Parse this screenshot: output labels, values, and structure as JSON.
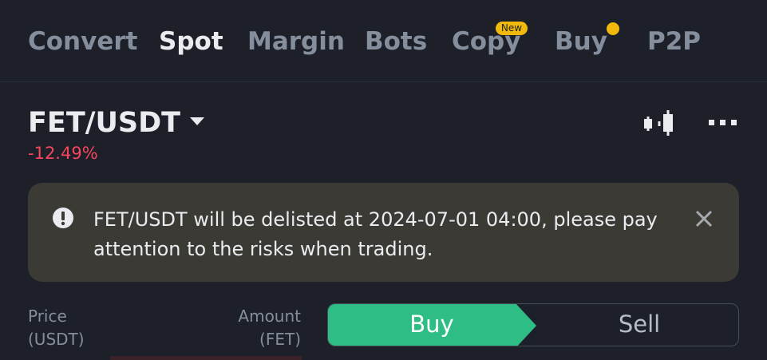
{
  "tabs": [
    {
      "label": "Convert"
    },
    {
      "label": "Spot"
    },
    {
      "label": "Margin"
    },
    {
      "label": "Bots"
    },
    {
      "label": "Copy"
    },
    {
      "label": "Buy"
    },
    {
      "label": "P2P"
    }
  ],
  "active_tab": "Spot",
  "copy_badge": "New",
  "pair": {
    "symbol": "FET/USDT",
    "change": "-12.49%"
  },
  "header_icons": [
    "candlestick-chart-icon",
    "more-icon"
  ],
  "alert": {
    "icon": "exclamation-icon",
    "line1": "FET/USDT will be delisted at 2024-07-01 04:00, please pay",
    "line2": "attention to the risks when trading."
  },
  "order_form": {
    "price_label": "Price",
    "price_unit": "(USDT)",
    "amount_label": "Amount",
    "amount_unit": "(FET)",
    "buy_label": "Buy",
    "sell_label": "Sell",
    "selected_side": "Buy"
  },
  "colors": {
    "background": "#1e2029",
    "buy": "#2ebd85",
    "sell_text": "#b7bdc6",
    "negative": "#f6465d",
    "accent": "#f0b90b",
    "alert_bg": "#3c3a35"
  }
}
